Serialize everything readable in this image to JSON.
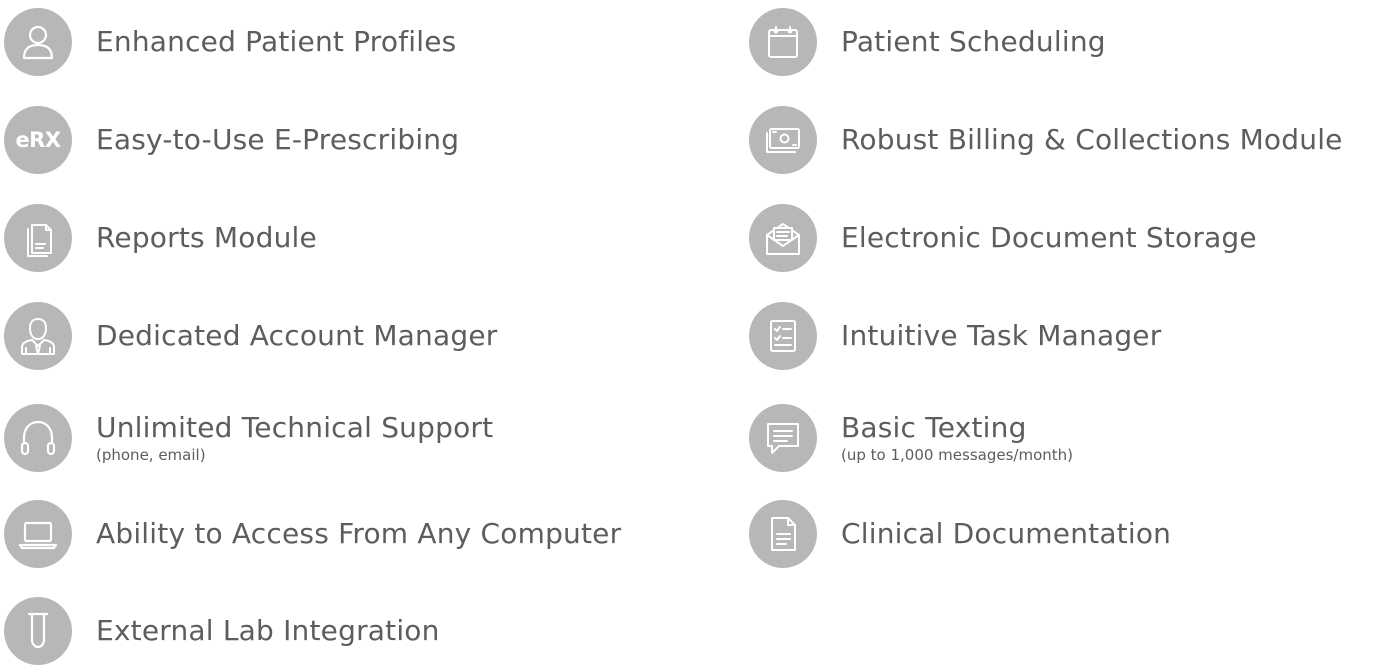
{
  "left_column": [
    {
      "icon": "user-icon",
      "label": "Enhanced Patient Profiles"
    },
    {
      "icon": "erx-icon",
      "icon_text": "eRX",
      "label": "Easy-to-Use E-Prescribing"
    },
    {
      "icon": "documents-icon",
      "label": "Reports Module"
    },
    {
      "icon": "account-manager-icon",
      "label": "Dedicated Account Manager"
    },
    {
      "icon": "headphones-icon",
      "label": "Unlimited Technical Support",
      "sublabel": "(phone, email)"
    },
    {
      "icon": "laptop-icon",
      "label": "Ability to Access From Any Computer"
    },
    {
      "icon": "test-tube-icon",
      "label": "External Lab Integration"
    }
  ],
  "right_column": [
    {
      "icon": "calendar-icon",
      "label": "Patient Scheduling"
    },
    {
      "icon": "money-icon",
      "label": "Robust Billing & Collections Module"
    },
    {
      "icon": "envelope-icon",
      "label": "Electronic Document Storage"
    },
    {
      "icon": "checklist-icon",
      "label": "Intuitive Task Manager"
    },
    {
      "icon": "chat-icon",
      "label": "Basic Texting",
      "sublabel": "(up to 1,000 messages/month)"
    },
    {
      "icon": "document-icon",
      "label": "Clinical Documentation"
    }
  ],
  "colors": {
    "icon_background": "#b7b7b7",
    "icon_foreground": "#ffffff",
    "text": "#5d5d5d"
  }
}
